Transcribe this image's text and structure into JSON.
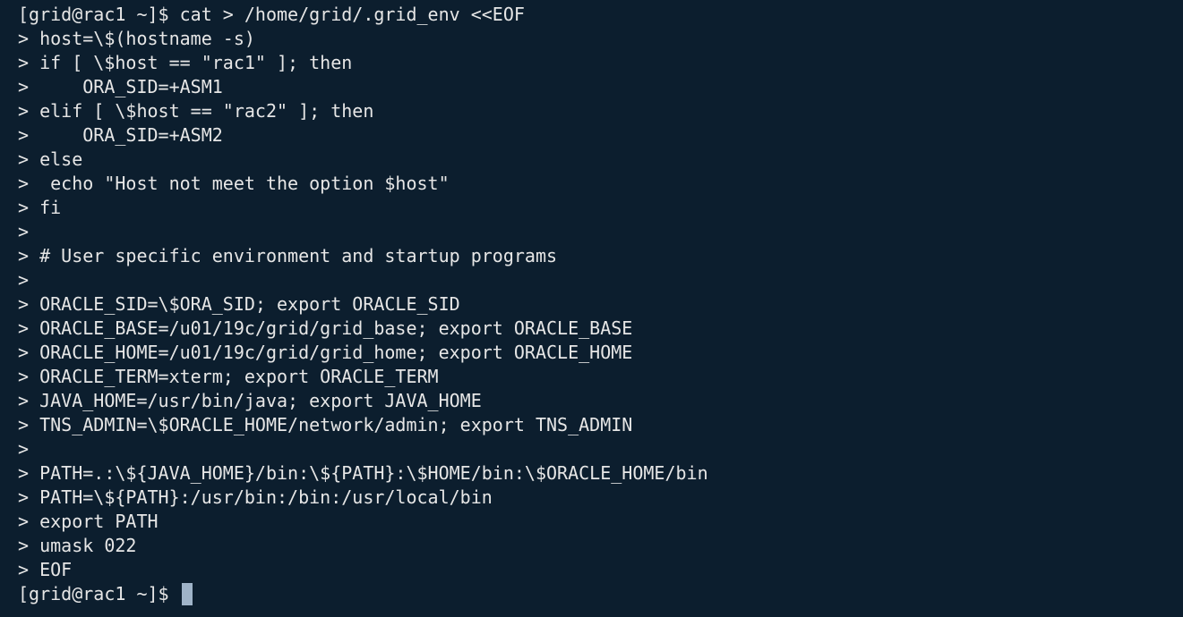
{
  "terminal": {
    "lines": [
      "[grid@rac1 ~]$ cat > /home/grid/.grid_env <<EOF",
      "> host=\\$(hostname -s)",
      "> if [ \\$host == \"rac1\" ]; then",
      ">     ORA_SID=+ASM1",
      "> elif [ \\$host == \"rac2\" ]; then",
      ">     ORA_SID=+ASM2",
      "> else",
      ">  echo \"Host not meet the option $host\"",
      "> fi",
      ">",
      "> # User specific environment and startup programs",
      ">",
      "> ORACLE_SID=\\$ORA_SID; export ORACLE_SID",
      "> ORACLE_BASE=/u01/19c/grid/grid_base; export ORACLE_BASE",
      "> ORACLE_HOME=/u01/19c/grid/grid_home; export ORACLE_HOME",
      "> ORACLE_TERM=xterm; export ORACLE_TERM",
      "> JAVA_HOME=/usr/bin/java; export JAVA_HOME",
      "> TNS_ADMIN=\\$ORACLE_HOME/network/admin; export TNS_ADMIN",
      ">",
      "> PATH=.:\\${JAVA_HOME}/bin:\\${PATH}:\\$HOME/bin:\\$ORACLE_HOME/bin",
      "> PATH=\\${PATH}:/usr/bin:/bin:/usr/local/bin",
      "> export PATH",
      "> umask 022",
      "> EOF"
    ],
    "prompt": "[grid@rac1 ~]$ ",
    "colors": {
      "background": "#0c1e2e",
      "foreground": "#e6e6e6",
      "cursor": "#9fb3c8"
    }
  }
}
